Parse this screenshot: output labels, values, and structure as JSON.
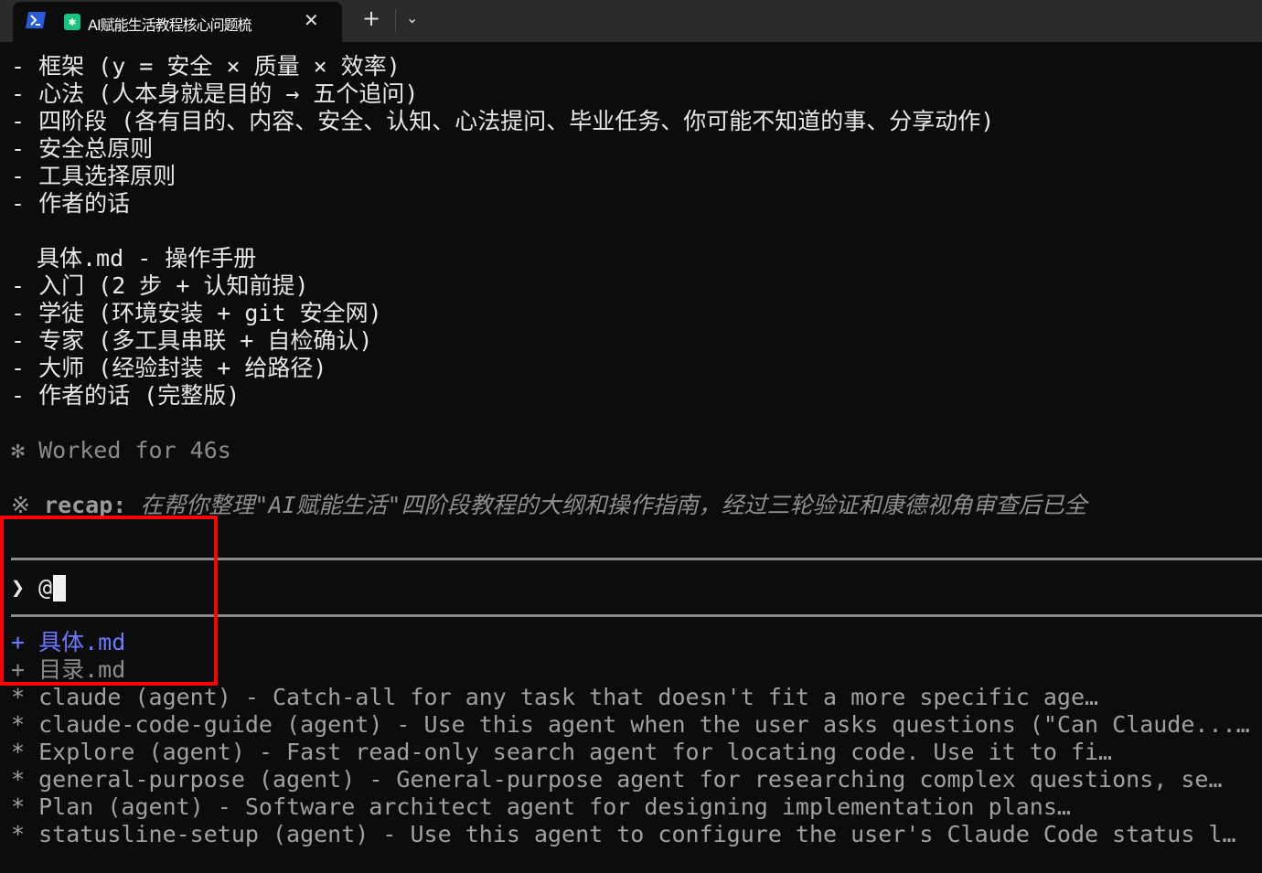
{
  "window": {
    "tab_title": "AI赋能生活教程核心问题梳",
    "close_label": "✕",
    "new_tab_label": "+",
    "dropdown_label": "⌄"
  },
  "content": {
    "framework_items": [
      "- 框架 (y = 安全 × 质量 × 效率)",
      "- 心法 (人本身就是目的 → 五个追问)",
      "- 四阶段 (各有目的、内容、安全、认知、心法提问、毕业任务、你可能不知道的事、分享动作)",
      "- 安全总原则",
      "- 工具选择原则",
      "- 作者的话"
    ],
    "manual_heading": "具体.md - 操作手册",
    "manual_items": [
      "- 入门 (2 步 + 认知前提)",
      "- 学徒 (环境安装 + git 安全网)",
      "- 专家 (多工具串联 + 自检确认)",
      "- 大师 (经验封装 + 给路径)",
      "- 作者的话 (完整版)"
    ],
    "worked": "✻ Worked for 46s",
    "recap_symbol": "※",
    "recap_label": "recap:",
    "recap_text": "在帮你整理\"AI赋能生活\"四阶段教程的大纲和操作指南，经过三轮验证和康德视角审查后已全"
  },
  "prompt": {
    "arrow": "❯",
    "value": "@"
  },
  "suggestions": {
    "files": [
      "+ 具体.md",
      "+ 目录.md"
    ],
    "agents": [
      "* claude (agent) - Catch-all for any task that doesn't fit a more specific age…",
      "* claude-code-guide (agent) - Use this agent when the user asks questions (\"Can Claude...…",
      "* Explore (agent) - Fast read-only search agent for locating code. Use it to fi…",
      "* general-purpose (agent) - General-purpose agent for researching complex questions, se…",
      "* Plan (agent) - Software architect agent for designing implementation plans…",
      "* statusline-setup (agent) - Use this agent to configure the user's Claude Code status l…"
    ]
  }
}
